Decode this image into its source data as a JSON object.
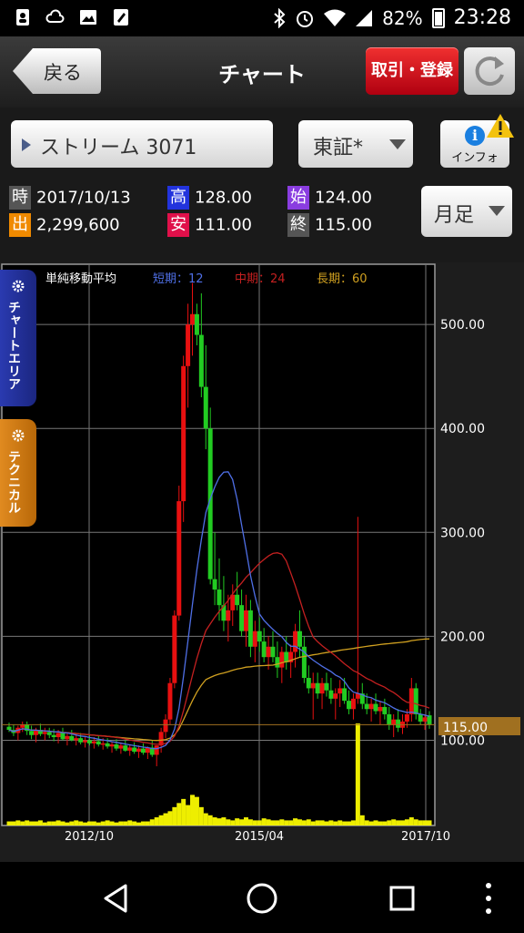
{
  "status": {
    "battery": "82%",
    "time": "23:28",
    "left_icons": [
      "contacts-icon",
      "cloud-icon",
      "image-icon",
      "edit-icon"
    ],
    "right_icons": [
      "bluetooth-icon",
      "alarm-icon",
      "wifi-icon",
      "signal-icon",
      "battery-icon"
    ]
  },
  "header": {
    "back_label": "戻る",
    "title": "チャート",
    "trade_label": "取引・登録"
  },
  "toolbar": {
    "stock_label": "ストリーム 3071",
    "market_label": "東証*",
    "info_label": "インフォ",
    "period_label": "月足"
  },
  "quote": {
    "time_badge": "時",
    "time_value": "2017/10/13",
    "volume_badge": "出",
    "volume_value": "2,299,600",
    "high_badge": "高",
    "high_value": "128.00",
    "low_badge": "安",
    "low_value": "111.00",
    "open_badge": "始",
    "open_value": "124.00",
    "close_badge": "終",
    "close_value": "115.00"
  },
  "side_tabs": {
    "chart_area": "チャートエリア",
    "technical": "テクニカル"
  },
  "colors": {
    "time_badge": "#555555",
    "volume_badge": "#f08a00",
    "high_badge": "#2233dd",
    "low_badge": "#e0104a",
    "open_badge": "#8a3de0",
    "close_badge": "#555555",
    "up_candle": "#e81010",
    "down_candle": "#22cc22",
    "ma_short": "#4f6fe6",
    "ma_mid": "#c42020",
    "ma_long": "#d0a020",
    "volume_bar": "#eeee00",
    "price_tag": "#a07020",
    "chart_area_tab": "#23339a",
    "technical_tab": "#d07a10"
  },
  "chart_data": {
    "type": "candlestick",
    "title": "単純移動平均",
    "legend": [
      {
        "label": "短期：12",
        "color": "#4f6fe6"
      },
      {
        "label": "中期：24",
        "color": "#c42020"
      },
      {
        "label": "長期：60",
        "color": "#d0a020"
      }
    ],
    "y_ticks": [
      "500.00",
      "400.00",
      "300.00",
      "200.00",
      "100.00"
    ],
    "y_tick_values": [
      500,
      400,
      300,
      200,
      100
    ],
    "x_ticks": [
      "2012/10",
      "2015/04",
      "2017/10"
    ],
    "last_price_label": "115.00",
    "last_price": 115,
    "ylim": [
      18,
      558
    ],
    "grid": true,
    "candles": [
      [
        113,
        117,
        108,
        110
      ],
      [
        110,
        115,
        104,
        107
      ],
      [
        107,
        114,
        100,
        112
      ],
      [
        112,
        118,
        108,
        115
      ],
      [
        115,
        118,
        105,
        109
      ],
      [
        109,
        114,
        101,
        105
      ],
      [
        105,
        112,
        98,
        110
      ],
      [
        110,
        116,
        104,
        106
      ],
      [
        106,
        112,
        100,
        108
      ],
      [
        108,
        112,
        102,
        105
      ],
      [
        105,
        111,
        99,
        103
      ],
      [
        103,
        110,
        97,
        107
      ],
      [
        107,
        112,
        100,
        101
      ],
      [
        101,
        107,
        95,
        104
      ],
      [
        104,
        110,
        99,
        100
      ],
      [
        100,
        106,
        95,
        102
      ],
      [
        102,
        107,
        96,
        98
      ],
      [
        98,
        104,
        93,
        100
      ],
      [
        100,
        105,
        95,
        97
      ],
      [
        97,
        103,
        92,
        99
      ],
      [
        99,
        104,
        94,
        96
      ],
      [
        96,
        102,
        91,
        97
      ],
      [
        97,
        102,
        92,
        94
      ],
      [
        94,
        99,
        88,
        96
      ],
      [
        96,
        101,
        90,
        92
      ],
      [
        92,
        98,
        87,
        95
      ],
      [
        95,
        100,
        89,
        90
      ],
      [
        90,
        96,
        85,
        93
      ],
      [
        93,
        98,
        87,
        89
      ],
      [
        89,
        95,
        83,
        92
      ],
      [
        92,
        97,
        86,
        88
      ],
      [
        88,
        94,
        82,
        93
      ],
      [
        93,
        100,
        84,
        86
      ],
      [
        86,
        95,
        75,
        95
      ],
      [
        95,
        112,
        88,
        108
      ],
      [
        108,
        125,
        102,
        120
      ],
      [
        120,
        160,
        115,
        155
      ],
      [
        155,
        225,
        150,
        220
      ],
      [
        220,
        345,
        215,
        330
      ],
      [
        330,
        470,
        310,
        460
      ],
      [
        460,
        520,
        420,
        500
      ],
      [
        500,
        540,
        470,
        510
      ],
      [
        510,
        520,
        480,
        490
      ],
      [
        490,
        530,
        430,
        440
      ],
      [
        440,
        480,
        380,
        400
      ],
      [
        400,
        420,
        250,
        255
      ],
      [
        255,
        300,
        230,
        245
      ],
      [
        245,
        275,
        215,
        230
      ],
      [
        230,
        258,
        205,
        215
      ],
      [
        215,
        240,
        195,
        225
      ],
      [
        225,
        250,
        210,
        240
      ],
      [
        240,
        262,
        225,
        230
      ],
      [
        230,
        245,
        200,
        205
      ],
      [
        205,
        240,
        190,
        225
      ],
      [
        225,
        235,
        180,
        190
      ],
      [
        190,
        215,
        175,
        205
      ],
      [
        205,
        218,
        185,
        195
      ],
      [
        195,
        208,
        175,
        180
      ],
      [
        180,
        200,
        168,
        190
      ],
      [
        190,
        205,
        175,
        180
      ],
      [
        180,
        195,
        160,
        170
      ],
      [
        170,
        190,
        155,
        185
      ],
      [
        185,
        200,
        168,
        175
      ],
      [
        175,
        192,
        160,
        185
      ],
      [
        185,
        212,
        170,
        205
      ],
      [
        205,
        225,
        180,
        190
      ],
      [
        190,
        200,
        155,
        160
      ],
      [
        160,
        172,
        145,
        150
      ],
      [
        150,
        165,
        120,
        155
      ],
      [
        155,
        165,
        140,
        145
      ],
      [
        145,
        160,
        130,
        155
      ],
      [
        155,
        165,
        142,
        148
      ],
      [
        148,
        160,
        135,
        140
      ],
      [
        140,
        150,
        120,
        145
      ],
      [
        145,
        158,
        132,
        150
      ],
      [
        150,
        160,
        135,
        138
      ],
      [
        138,
        148,
        125,
        130
      ],
      [
        130,
        145,
        120,
        140
      ],
      [
        140,
        315,
        135,
        145
      ],
      [
        145,
        155,
        130,
        135
      ],
      [
        135,
        145,
        125,
        130
      ],
      [
        130,
        140,
        118,
        135
      ],
      [
        135,
        145,
        125,
        128
      ],
      [
        128,
        138,
        115,
        132
      ],
      [
        132,
        140,
        120,
        125
      ],
      [
        125,
        132,
        110,
        115
      ],
      [
        115,
        125,
        103,
        120
      ],
      [
        120,
        130,
        108,
        112
      ],
      [
        112,
        125,
        106,
        118
      ],
      [
        118,
        130,
        112,
        125
      ],
      [
        125,
        160,
        118,
        150
      ],
      [
        150,
        155,
        120,
        125
      ],
      [
        125,
        130,
        115,
        118
      ],
      [
        118,
        125,
        110,
        122
      ],
      [
        124,
        128,
        111,
        115
      ]
    ],
    "volume": [
      0.04,
      0.04,
      0.05,
      0.04,
      0.05,
      0.04,
      0.04,
      0.05,
      0.03,
      0.04,
      0.04,
      0.05,
      0.04,
      0.03,
      0.04,
      0.05,
      0.04,
      0.03,
      0.04,
      0.04,
      0.03,
      0.04,
      0.05,
      0.04,
      0.03,
      0.04,
      0.04,
      0.05,
      0.04,
      0.03,
      0.04,
      0.04,
      0.06,
      0.08,
      0.1,
      0.12,
      0.14,
      0.18,
      0.22,
      0.26,
      0.2,
      0.3,
      0.28,
      0.18,
      0.12,
      0.1,
      0.08,
      0.07,
      0.08,
      0.06,
      0.05,
      0.07,
      0.06,
      0.08,
      0.06,
      0.05,
      0.05,
      0.07,
      0.06,
      0.05,
      0.05,
      0.06,
      0.05,
      0.05,
      0.07,
      0.06,
      0.05,
      0.06,
      0.04,
      0.05,
      0.05,
      0.04,
      0.05,
      0.04,
      0.05,
      0.04,
      0.04,
      0.05,
      1.0,
      0.1,
      0.05,
      0.04,
      0.05,
      0.04,
      0.04,
      0.05,
      0.06,
      0.05,
      0.05,
      0.06,
      0.08,
      0.06,
      0.05,
      0.05,
      0.05
    ]
  }
}
